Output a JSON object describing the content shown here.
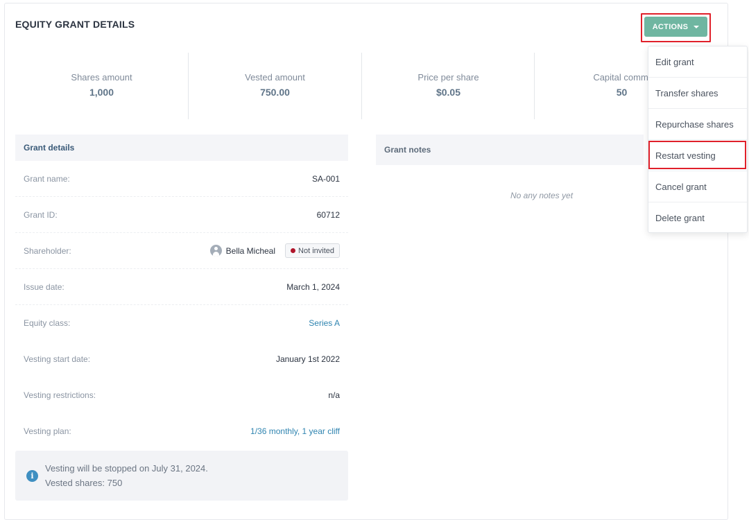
{
  "header": {
    "title": "EQUITY GRANT DETAILS",
    "actions_label": "ACTIONS"
  },
  "stats": [
    {
      "label": "Shares amount",
      "value": "1,000"
    },
    {
      "label": "Vested amount",
      "value": "750.00"
    },
    {
      "label": "Price per share",
      "value": "$0.05"
    },
    {
      "label": "Capital commi",
      "value": "50"
    }
  ],
  "grant_details": {
    "title": "Grant details",
    "rows": {
      "grant_name": {
        "label": "Grant name:",
        "value": "SA-001"
      },
      "grant_id": {
        "label": "Grant ID:",
        "value": "60712"
      },
      "shareholder": {
        "label": "Shareholder:",
        "name": "Bella Micheal",
        "status": "Not invited"
      },
      "issue_date": {
        "label": "Issue date:",
        "value": "March 1, 2024"
      },
      "equity_class": {
        "label": "Equity class:",
        "value": "Series A"
      },
      "vesting_start": {
        "label": "Vesting start date:",
        "value": "January 1st 2022"
      },
      "vesting_restrictions": {
        "label": "Vesting restrictions:",
        "value": "n/a"
      },
      "vesting_plan": {
        "label": "Vesting plan:",
        "value": "1/36 monthly, 1 year cliff"
      }
    }
  },
  "notice": {
    "icon_text": "i",
    "line1": "Vesting will be stopped on July 31, 2024.",
    "line2": "Vested shares: 750"
  },
  "grant_notes": {
    "title": "Grant notes",
    "empty_text": "No any notes yet"
  },
  "actions_menu": {
    "items": [
      "Edit grant",
      "Transfer shares",
      "Repurchase shares",
      "Restart vesting",
      "Cancel grant",
      "Delete grant"
    ],
    "highlighted": "Restart vesting"
  },
  "colors": {
    "accent": "#6fb6a1",
    "link": "#2f84b0",
    "highlight": "#e0202a",
    "status_dot": "#b0152a"
  }
}
